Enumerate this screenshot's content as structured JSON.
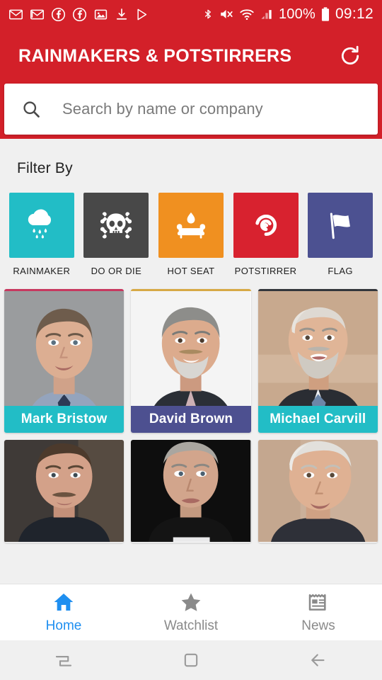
{
  "status_bar": {
    "left_icons": [
      "gmail-icon",
      "gmail-icon",
      "facebook-icon",
      "facebook-icon",
      "photos-icon",
      "download-icon",
      "play-store-icon"
    ],
    "right_icons": [
      "bluetooth-icon",
      "mute-icon",
      "wifi-icon",
      "signal-icon"
    ],
    "battery_percent": "100%",
    "battery_icon": "battery-full-icon",
    "time": "09:12"
  },
  "appbar": {
    "title": "RAINMAKERS & POTSTIRRERS",
    "refresh_icon": "refresh-icon",
    "background": "#d32029"
  },
  "search": {
    "icon": "search-icon",
    "placeholder": "Search by name or company",
    "value": ""
  },
  "filter": {
    "title": "Filter By",
    "items": [
      {
        "label": "RAINMAKER",
        "color": "#22bdc6",
        "icon": "rain-cloud-icon"
      },
      {
        "label": "DO OR DIE",
        "color": "#484848",
        "icon": "skull-crossbones-icon"
      },
      {
        "label": "HOT SEAT",
        "color": "#f09020",
        "icon": "hot-seat-sofa-icon"
      },
      {
        "label": "POTSTIRRER",
        "color": "#d8222f",
        "icon": "spiral-swirl-icon"
      },
      {
        "label": "FLAG",
        "color": "#4c5191",
        "icon": "flag-icon"
      }
    ]
  },
  "people": [
    {
      "name": "Mark Bristow",
      "accent": "#c8385f",
      "name_bg": "#22bdc6",
      "photo": {
        "bg": "#9a9c9e",
        "skin": "#d9ac90",
        "hair": "#6e5c4c",
        "shirt": "#9fb0cb",
        "tie": "#2c3a55"
      }
    },
    {
      "name": "David Brown",
      "accent": "#d7a945",
      "name_bg": "#4d5090",
      "photo": {
        "bg": "#f4f4f4",
        "skin": "#d8a78c",
        "hair": "#8d8d8a",
        "shirt": "#2b2f36",
        "tie": "#c9a8a8"
      }
    },
    {
      "name": "Michael Carvill",
      "accent": "#33363b",
      "name_bg": "#22bdc6",
      "photo": {
        "bg": "#c8a98e",
        "skin": "#e0b597",
        "hair": "#c9c4bd",
        "shirt": "#2a2d33",
        "tie": "#6d86a8"
      }
    },
    {
      "name": "",
      "accent": "#cfcfcf",
      "name_bg": "#22bdc6",
      "photo": {
        "bg": "#3f3a37",
        "skin": "#d3a189",
        "hair": "#4c3a2c",
        "shirt": "#1f242c",
        "tie": "#39455a"
      }
    },
    {
      "name": "",
      "accent": "#cfcfcf",
      "name_bg": "#4d5090",
      "photo": {
        "bg": "#0e0e0e",
        "skin": "#d2a58c",
        "hair": "#a9a6a0",
        "shirt": "#141414",
        "tie": "#2a2a2a"
      }
    },
    {
      "name": "",
      "accent": "#cfcfcf",
      "name_bg": "#22bdc6",
      "photo": {
        "bg": "#cbb09a",
        "skin": "#dfb193",
        "hair": "#e2e0dc",
        "shirt": "#2e3038",
        "tie": "#5a5f6b"
      }
    }
  ],
  "bottom_nav": {
    "active_color": "#1f8ff0",
    "items": [
      {
        "label": "Home",
        "icon": "home-icon",
        "active": true
      },
      {
        "label": "Watchlist",
        "icon": "star-icon",
        "active": false
      },
      {
        "label": "News",
        "icon": "newspaper-icon",
        "active": false
      }
    ]
  },
  "android_nav": {
    "items": [
      {
        "icon": "recents-icon"
      },
      {
        "icon": "home-square-icon"
      },
      {
        "icon": "back-arrow-icon"
      }
    ]
  }
}
